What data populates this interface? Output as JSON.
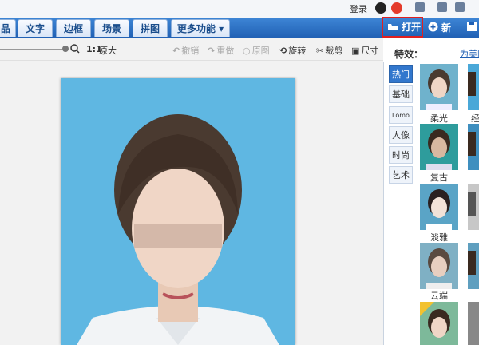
{
  "titlebar": {
    "login": "登录"
  },
  "menu": {
    "tabs": [
      {
        "label": "品"
      },
      {
        "label": "文字"
      },
      {
        "label": "边框"
      },
      {
        "label": "场景"
      },
      {
        "label": "拼图"
      },
      {
        "label": "更多功能 ▾"
      }
    ],
    "open_label": "打开",
    "new_label": "新建"
  },
  "toolbar": {
    "zoom_ratio": "1:1",
    "original_size": "原大",
    "undo": "撤销",
    "redo": "重做",
    "original": "原图",
    "rotate": "旋转",
    "crop": "裁剪",
    "size": "尺寸"
  },
  "panel": {
    "title": "特效：",
    "link": "为美图",
    "categories": [
      "热门",
      "基础",
      "Lomo",
      "人像",
      "时尚",
      "艺术"
    ],
    "effects": [
      {
        "label": "柔光",
        "color": "#6fb2cc"
      },
      {
        "label": "复古",
        "color": "#2e9c9c"
      },
      {
        "label": "淡雅",
        "color": "#5aa4c6"
      },
      {
        "label": "云端",
        "color": "#7fb0c4"
      },
      {
        "label": "",
        "color": "#7db99a"
      }
    ],
    "effects_right": [
      {
        "label": "经",
        "color": "#4aa8d8"
      },
      {
        "label": "",
        "color": "#3f8fbf"
      },
      {
        "label": "",
        "color": "#c7c7c7"
      },
      {
        "label": "",
        "color": "#5f9fbf"
      },
      {
        "label": "",
        "color": "#888888"
      }
    ]
  },
  "colors": {
    "accent": "#1f5fb3",
    "photo_bg": "#5fb7e2",
    "highlight": "#e02020"
  }
}
